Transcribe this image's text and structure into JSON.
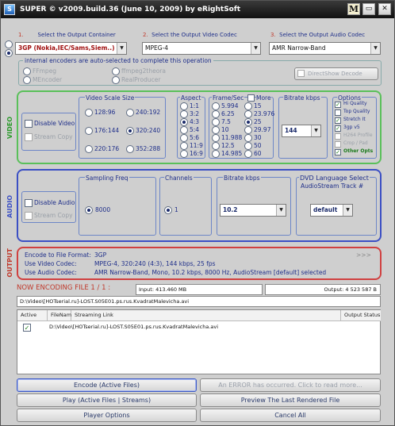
{
  "window": {
    "title": "SUPER © v2009.build.36 (June 10, 2009) by eRightSoft",
    "m_label": "M",
    "restore_label": "▭",
    "close_label": "✕"
  },
  "headers": {
    "container": {
      "num": "1.",
      "label": "Select the Output Container"
    },
    "video_codec": {
      "num": "2.",
      "label": "Select the Output Video Codec"
    },
    "audio_codec": {
      "num": "3.",
      "label": "Select the Output Audio Codec"
    }
  },
  "combos": {
    "container": "3GP (Nokia,IEC/Sams,Siem..)",
    "video_codec": "MPEG-4",
    "audio_codec": "AMR Narrow-Band"
  },
  "encoders": {
    "title": "internal encoders are auto-selected to complete this operation",
    "ffmpeg": "FFmpeg",
    "mencoder": "MEncoder",
    "ffmpeg2theora": "ffmpeg2theora",
    "realproducer": "RealProducer",
    "directshow": "DirectShow Decode"
  },
  "video": {
    "side": "VIDEO",
    "disable": "Disable Video",
    "stream_copy": "Stream Copy",
    "scale": {
      "title": "Video Scale Size",
      "options": [
        "128:96",
        "240:192",
        "176:144",
        "320:240",
        "220:176",
        "352:288"
      ],
      "selected": "320:240"
    },
    "aspect": {
      "title": "Aspect",
      "options": [
        "1:1",
        "3:2",
        "4:3",
        "5:4",
        "5:6",
        "11:9",
        "16:9"
      ],
      "selected": "4:3"
    },
    "fps": {
      "title": "Frame/Sec",
      "more": "More",
      "options": [
        "5.994",
        "15",
        "6.25",
        "23.976",
        "7.5",
        "25",
        "10",
        "29.97",
        "11.988",
        "30",
        "12.5",
        "50",
        "14.985",
        "60"
      ],
      "selected": "25"
    },
    "bitrate": {
      "title": "Bitrate  kbps",
      "value": "144"
    },
    "options": {
      "title": "Options",
      "items": [
        "Hi Quality",
        "Top Quality",
        "Stretch It",
        "3gp v5",
        "H264 Profile",
        "Crop / Pad",
        "Other Opts"
      ]
    }
  },
  "audio": {
    "side": "AUDIO",
    "disable": "Disable Audio",
    "stream_copy": "Stream Copy",
    "freq": {
      "title": "Sampling Freq",
      "value": "8000"
    },
    "channels": {
      "title": "Channels",
      "value": "1"
    },
    "bitrate": {
      "title": "Bitrate  kbps",
      "value": "10.2"
    },
    "dvd": {
      "title": "DVD Language Select",
      "subtitle": "AudioStream  Track #",
      "value": "default"
    }
  },
  "output": {
    "side": "OUTPUT",
    "more": ">>>",
    "format_label": "Encode to File Format:",
    "format_value": "3GP",
    "video_label": "Use Video Codec:",
    "video_value": "MPEG-4,  320:240 (4:3),  144 kbps,  25 fps",
    "audio_label": "Use Audio Codec:",
    "audio_value": "AMR Narrow-Band,  Mono,  10.2 kbps,  8000 Hz,  AudioStream [default] selected"
  },
  "encoding": {
    "now": "NOW ENCODING FILE 1 / 1 :",
    "input": "Input: 413.460 MB",
    "output": "Output: 4 523 587 B",
    "path": "D:\\Video\\[HOTserial.ru]-LOST.S05E01.ps.rus.KvadratMalevicha.avi"
  },
  "table": {
    "columns": [
      "Active",
      "FileName",
      "Streaming Link",
      "Output Status"
    ],
    "rows": [
      {
        "file": "D:\\Video\\[HOTserial.ru]-LOST.S05E01.ps.rus.KvadratMalevicha.avi"
      }
    ]
  },
  "buttons": {
    "encode": "Encode (Active Files)",
    "error": "An ERROR has occurred. Click to read more...",
    "play": "Play (Active Files | Streams)",
    "preview": "Preview The Last Rendered File",
    "player_options": "Player Options",
    "cancel": "Cancel All"
  }
}
